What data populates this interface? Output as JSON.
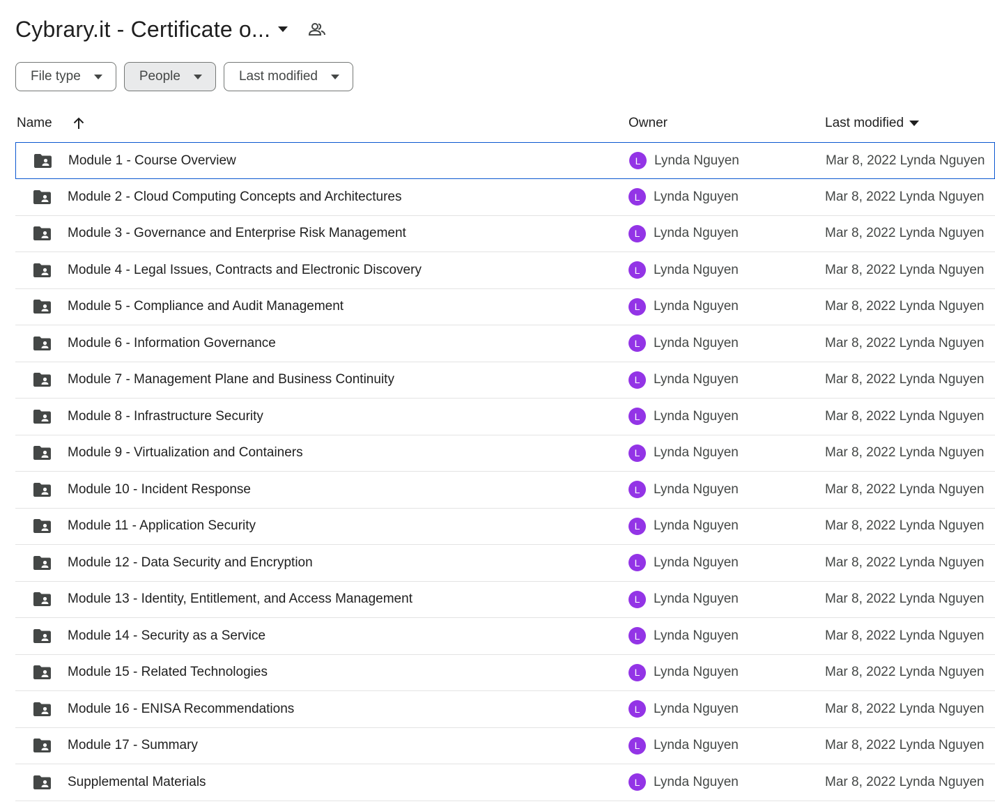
{
  "header": {
    "title": "Cybrary.it - Certificate o...",
    "caret_icon": "arrow-drop-down-icon",
    "shared_icon": "people-icon"
  },
  "filters": [
    {
      "label": "File type",
      "active": false
    },
    {
      "label": "People",
      "active": true
    },
    {
      "label": "Last modified",
      "active": false
    }
  ],
  "columns": {
    "name": "Name",
    "owner": "Owner",
    "last_modified": "Last modified"
  },
  "colors": {
    "avatar": "#9334e6",
    "selection_border": "#0b57d0",
    "folder_icon": "#444746"
  },
  "rows": [
    {
      "name": "Module 1 - Course Overview",
      "owner_initial": "L",
      "owner": "Lynda Nguyen",
      "modified": "Mar 8, 2022 Lynda Nguyen",
      "selected": true
    },
    {
      "name": "Module 2 - Cloud Computing Concepts and Architectures",
      "owner_initial": "L",
      "owner": "Lynda Nguyen",
      "modified": "Mar 8, 2022 Lynda Nguyen"
    },
    {
      "name": "Module 3 - Governance and Enterprise Risk Management",
      "owner_initial": "L",
      "owner": "Lynda Nguyen",
      "modified": "Mar 8, 2022 Lynda Nguyen"
    },
    {
      "name": "Module 4 - Legal Issues, Contracts and Electronic Discovery",
      "owner_initial": "L",
      "owner": "Lynda Nguyen",
      "modified": "Mar 8, 2022 Lynda Nguyen"
    },
    {
      "name": "Module 5 - Compliance and Audit Management",
      "owner_initial": "L",
      "owner": "Lynda Nguyen",
      "modified": "Mar 8, 2022 Lynda Nguyen"
    },
    {
      "name": "Module 6 - Information Governance",
      "owner_initial": "L",
      "owner": "Lynda Nguyen",
      "modified": "Mar 8, 2022 Lynda Nguyen"
    },
    {
      "name": "Module 7 - Management Plane and Business Continuity",
      "owner_initial": "L",
      "owner": "Lynda Nguyen",
      "modified": "Mar 8, 2022 Lynda Nguyen"
    },
    {
      "name": "Module 8 - Infrastructure Security",
      "owner_initial": "L",
      "owner": "Lynda Nguyen",
      "modified": "Mar 8, 2022 Lynda Nguyen"
    },
    {
      "name": "Module 9 - Virtualization and Containers",
      "owner_initial": "L",
      "owner": "Lynda Nguyen",
      "modified": "Mar 8, 2022 Lynda Nguyen"
    },
    {
      "name": "Module 10 - Incident Response",
      "owner_initial": "L",
      "owner": "Lynda Nguyen",
      "modified": "Mar 8, 2022 Lynda Nguyen"
    },
    {
      "name": "Module 11 - Application Security",
      "owner_initial": "L",
      "owner": "Lynda Nguyen",
      "modified": "Mar 8, 2022 Lynda Nguyen"
    },
    {
      "name": "Module 12 - Data Security and Encryption",
      "owner_initial": "L",
      "owner": "Lynda Nguyen",
      "modified": "Mar 8, 2022 Lynda Nguyen"
    },
    {
      "name": "Module 13 - Identity, Entitlement, and Access Management",
      "owner_initial": "L",
      "owner": "Lynda Nguyen",
      "modified": "Mar 8, 2022 Lynda Nguyen"
    },
    {
      "name": "Module 14 - Security as a Service",
      "owner_initial": "L",
      "owner": "Lynda Nguyen",
      "modified": "Mar 8, 2022 Lynda Nguyen"
    },
    {
      "name": "Module 15 - Related Technologies",
      "owner_initial": "L",
      "owner": "Lynda Nguyen",
      "modified": "Mar 8, 2022 Lynda Nguyen"
    },
    {
      "name": "Module 16 - ENISA Recommendations",
      "owner_initial": "L",
      "owner": "Lynda Nguyen",
      "modified": "Mar 8, 2022 Lynda Nguyen"
    },
    {
      "name": "Module 17 - Summary",
      "owner_initial": "L",
      "owner": "Lynda Nguyen",
      "modified": "Mar 8, 2022 Lynda Nguyen"
    },
    {
      "name": "Supplemental Materials",
      "owner_initial": "L",
      "owner": "Lynda Nguyen",
      "modified": "Mar 8, 2022 Lynda Nguyen"
    }
  ]
}
